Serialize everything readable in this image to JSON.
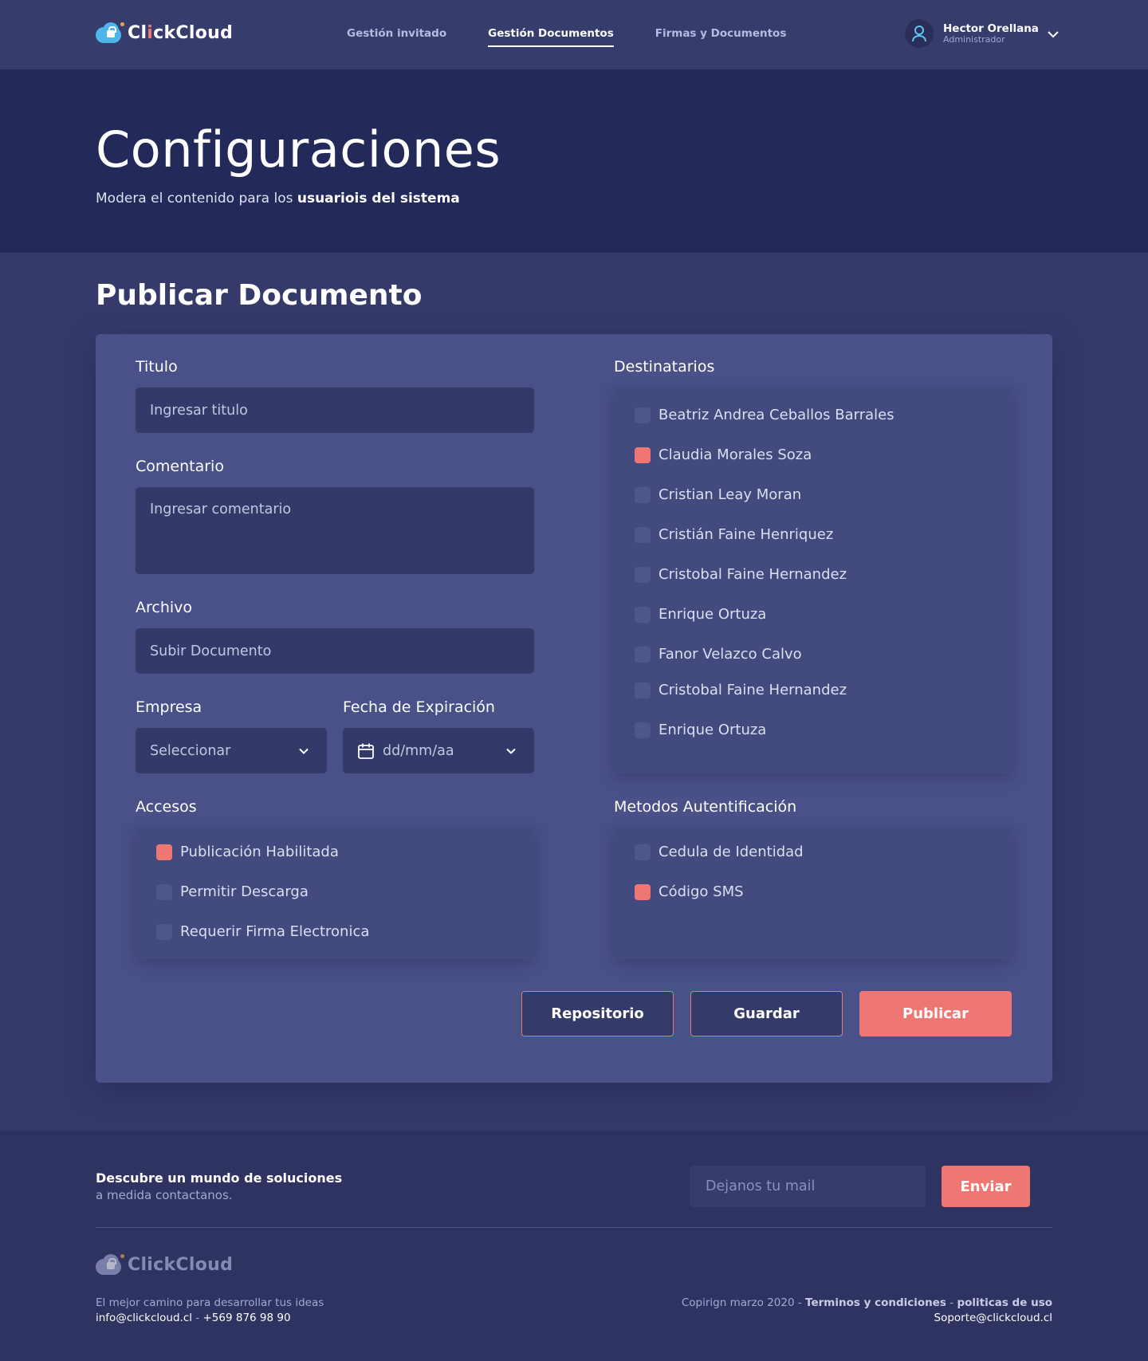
{
  "header": {
    "logo_prefix": "Cl",
    "logo_i": "i",
    "logo_suffix": "ckCloud",
    "nav": [
      "Gestión invitado",
      "Gestión Documentos",
      "Firmas y Documentos"
    ],
    "active_nav": "Gestión Documentos",
    "user_name": "Hector Orellana",
    "user_role": "Administrador"
  },
  "hero": {
    "title": "Configuraciones",
    "subtitle_prefix": "Modera el contenido para los ",
    "subtitle_bold": "usuariois del sistema"
  },
  "form": {
    "section_title": "Publicar Documento",
    "titulo_label": "Titulo",
    "titulo_placeholder": "Ingresar titulo",
    "comentario_label": "Comentario",
    "comentario_placeholder": "Ingresar comentario",
    "archivo_label": "Archivo",
    "archivo_placeholder": "Subir Documento",
    "empresa_label": "Empresa",
    "empresa_value": "Seleccionar",
    "fecha_label": "Fecha de Expiración",
    "fecha_value": "dd/mm/aa",
    "accesos_label": "Accesos",
    "accesos": [
      {
        "label": "Publicación Habilitada",
        "checked": true
      },
      {
        "label": "Permitir Descarga",
        "checked": false
      },
      {
        "label": "Requerir Firma Electronica",
        "checked": false
      }
    ],
    "destinatarios_label": "Destinatarios",
    "destinatarios": [
      {
        "label": "Beatriz Andrea Ceballos Barrales",
        "checked": false
      },
      {
        "label": "Claudia Morales Soza",
        "checked": true
      },
      {
        "label": "Cristian Leay Moran",
        "checked": false
      },
      {
        "label": "Cristián Faine Henriquez",
        "checked": false
      },
      {
        "label": "Cristobal Faine Hernandez",
        "checked": false
      },
      {
        "label": "Enrique Ortuza",
        "checked": false
      },
      {
        "label": "Fanor Velazco Calvo",
        "checked": false
      },
      {
        "label": "Cristobal Faine Hernandez",
        "checked": false
      },
      {
        "label": "Enrique Ortuza",
        "checked": false
      }
    ],
    "metodos_label": "Metodos Autentificación",
    "metodos": [
      {
        "label": "Cedula de Identidad",
        "checked": false
      },
      {
        "label": "Código SMS",
        "checked": true
      }
    ],
    "btn_repositorio": "Repositorio",
    "btn_guardar": "Guardar",
    "btn_publicar": "Publicar"
  },
  "footer": {
    "cta_title": "Descubre un mundo de soluciones",
    "cta_sub": "a medida contactanos.",
    "mail_placeholder": "Dejanos tu mail",
    "send_label": "Enviar",
    "tagline": "El mejor camino para desarrollar tus ideas",
    "email": "info@clickcloud.cl",
    "contact_sep": " - ",
    "phone": "+569 876 98 90",
    "copyright": "Copirign marzo 2020 - ",
    "terms": "Terminos y condiciones",
    "dash": " - ",
    "policies": "politicas de uso",
    "support": "Soporte@clickcloud.cl"
  },
  "colors": {
    "accent": "#ee7773",
    "background": "#363a6b",
    "hero": "#232958",
    "card": "#4a5189",
    "field": "#333a69"
  }
}
